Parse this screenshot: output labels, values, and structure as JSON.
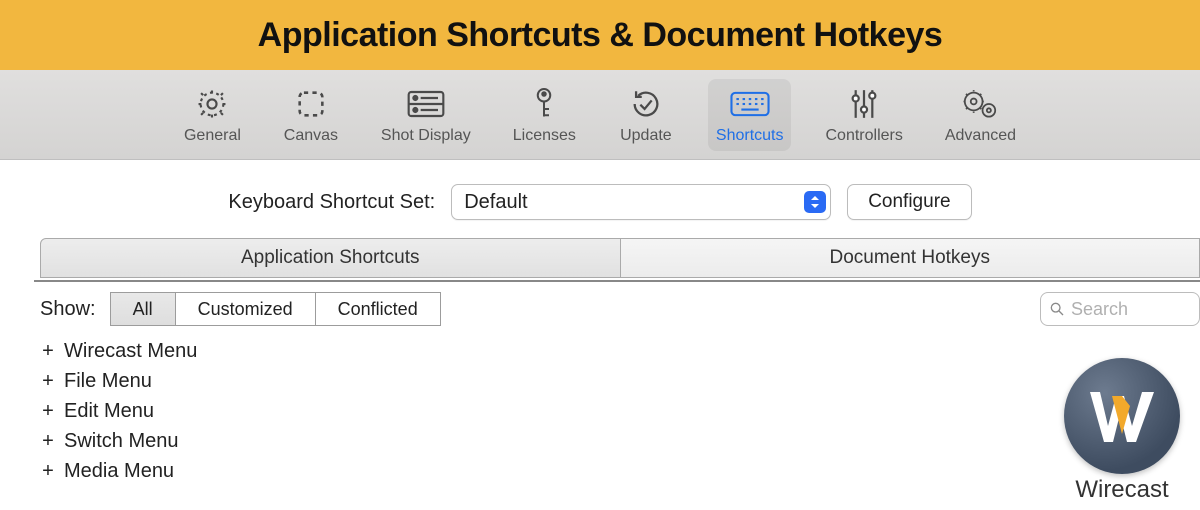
{
  "banner": {
    "title": "Application Shortcuts & Document Hotkeys"
  },
  "toolbar": {
    "items": [
      {
        "label": "General",
        "icon": "gear-icon"
      },
      {
        "label": "Canvas",
        "icon": "canvas-icon"
      },
      {
        "label": "Shot Display",
        "icon": "shot-display-icon"
      },
      {
        "label": "Licenses",
        "icon": "key-icon"
      },
      {
        "label": "Update",
        "icon": "update-icon"
      },
      {
        "label": "Shortcuts",
        "icon": "keyboard-icon",
        "selected": true
      },
      {
        "label": "Controllers",
        "icon": "sliders-icon"
      },
      {
        "label": "Advanced",
        "icon": "advanced-icon"
      }
    ]
  },
  "set": {
    "label": "Keyboard Shortcut Set:",
    "selected": "Default",
    "configure_label": "Configure"
  },
  "tabs": {
    "items": [
      {
        "label": "Application Shortcuts",
        "selected": true
      },
      {
        "label": "Document Hotkeys"
      }
    ]
  },
  "filter": {
    "show_label": "Show:",
    "segments": [
      {
        "label": "All",
        "selected": true
      },
      {
        "label": "Customized"
      },
      {
        "label": "Conflicted"
      }
    ],
    "search_placeholder": "Search"
  },
  "menus": [
    {
      "label": "Wirecast Menu"
    },
    {
      "label": "File Menu"
    },
    {
      "label": "Edit Menu"
    },
    {
      "label": "Switch Menu"
    },
    {
      "label": "Media Menu"
    }
  ],
  "brand": {
    "name": "Wirecast"
  },
  "colors": {
    "accent": "#1f6fe6",
    "banner": "#f2b73f"
  }
}
